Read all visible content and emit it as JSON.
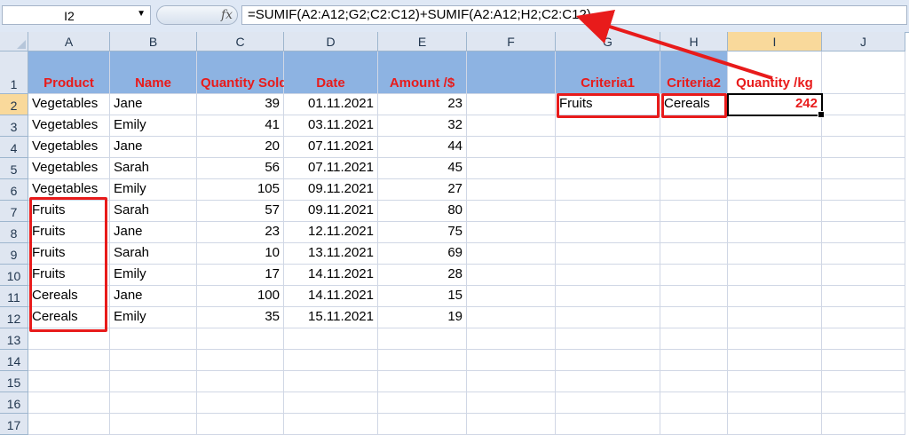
{
  "formula_bar": {
    "name_box": "I2",
    "fx_label": "fx",
    "formula": "=SUMIF(A2:A12;G2;C2:C12)+SUMIF(A2:A12;H2;C2:C12)"
  },
  "columns": [
    "A",
    "B",
    "C",
    "D",
    "E",
    "F",
    "G",
    "H",
    "I",
    "J"
  ],
  "selected_column": "I",
  "selected_row": "2",
  "rows": [
    "1",
    "2",
    "3",
    "4",
    "5",
    "6",
    "7",
    "8",
    "9",
    "10",
    "11",
    "12",
    "13",
    "14",
    "15",
    "16",
    "17"
  ],
  "header_row": {
    "product": "Product",
    "name": "Name",
    "quantity": "Quantity Sold /kg",
    "date": "Date",
    "amount": "Amount /$",
    "criteria1": "Criteria1",
    "criteria2": "Criteria2",
    "result": "Quantity /kg"
  },
  "data_rows": [
    {
      "product": "Vegetables",
      "name": "Jane",
      "quantity": "39",
      "date": "01.11.2021",
      "amount": "23"
    },
    {
      "product": "Vegetables",
      "name": "Emily",
      "quantity": "41",
      "date": "03.11.2021",
      "amount": "32"
    },
    {
      "product": "Vegetables",
      "name": "Jane",
      "quantity": "20",
      "date": "07.11.2021",
      "amount": "44"
    },
    {
      "product": "Vegetables",
      "name": "Sarah",
      "quantity": "56",
      "date": "07.11.2021",
      "amount": "45"
    },
    {
      "product": "Vegetables",
      "name": "Emily",
      "quantity": "105",
      "date": "09.11.2021",
      "amount": "27"
    },
    {
      "product": "Fruits",
      "name": "Sarah",
      "quantity": "57",
      "date": "09.11.2021",
      "amount": "80"
    },
    {
      "product": "Fruits",
      "name": "Jane",
      "quantity": "23",
      "date": "12.11.2021",
      "amount": "75"
    },
    {
      "product": "Fruits",
      "name": "Sarah",
      "quantity": "10",
      "date": "13.11.2021",
      "amount": "69"
    },
    {
      "product": "Fruits",
      "name": "Emily",
      "quantity": "17",
      "date": "14.11.2021",
      "amount": "28"
    },
    {
      "product": "Cereals",
      "name": "Jane",
      "quantity": "100",
      "date": "14.11.2021",
      "amount": "15"
    },
    {
      "product": "Cereals",
      "name": "Emily",
      "quantity": "35",
      "date": "15.11.2021",
      "amount": "19"
    }
  ],
  "criteria": {
    "criteria1_value": "Fruits",
    "criteria2_value": "Cereals",
    "result_value": "242"
  },
  "colors": {
    "header_fill": "#8db3e2",
    "header_text": "#e81b1b",
    "annotation": "#e81b1b",
    "selected_header": "#f9d99b"
  }
}
